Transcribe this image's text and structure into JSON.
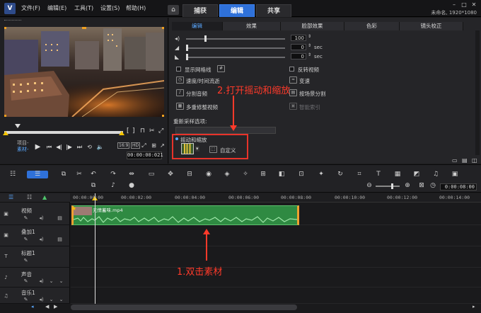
{
  "app": {
    "menu": [
      "文件(F)",
      "编辑(E)",
      "工具(T)",
      "设置(S)",
      "帮助(H)"
    ],
    "workspace_tabs": [
      "捕获",
      "编辑",
      "共享"
    ],
    "active_workspace": "编辑",
    "project_info": "未命名, 1920*1080"
  },
  "player": {
    "mode_project": "项目-",
    "mode_clip": "素材-",
    "timecode": "00:00:00:021",
    "aspect_label": "16:9",
    "hd_label": "HD"
  },
  "options": {
    "tabs": [
      "编辑",
      "效果",
      "脸部效果",
      "色彩",
      "镜头校正"
    ],
    "active_tab": "编辑",
    "volume_value": "100",
    "fade_in_value": "0",
    "fade_out_value": "0",
    "sec_unit": "sec",
    "show_grid": "显示网格线",
    "reverse_video": "反转视频",
    "speed_time": "速度/时间流逝",
    "variable_speed": "变速",
    "split_audio": "分割音频",
    "split_by_scene": "按场景分割",
    "multi_trim": "多重修整视频",
    "smart_render": "智能索引",
    "resample_label": "重新采样选项:",
    "pan_zoom_label": "摇动和缩放",
    "custom_label": "自定义"
  },
  "annotations": {
    "step1": "1.双击素材",
    "step2": "2.打开摇动和缩放"
  },
  "timeline": {
    "ruler_labels": [
      "00:00:00:00",
      "00:00:02:00",
      "00:00:04:00",
      "00:00:06:00",
      "00:00:08:00",
      "00:00:10:00",
      "00:00:12:00",
      "00:00:14:00"
    ],
    "timecode": "0:00:08:00",
    "tracks": [
      "视频",
      "叠加1",
      "标题1",
      "声音",
      "音乐1"
    ],
    "clip_name": "无情蓄味.mp4"
  },
  "colors": {
    "accent": "#2f71d9",
    "clip_green": "#2f8a42",
    "annotation_red": "#ff3a2a",
    "trim_orange": "#f0a030"
  }
}
